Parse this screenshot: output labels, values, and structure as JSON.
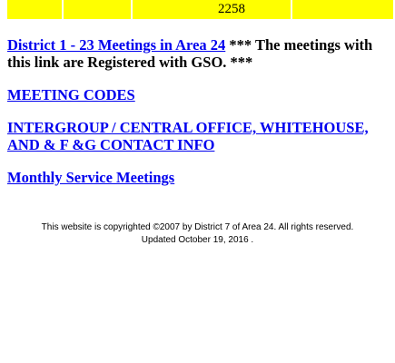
{
  "top_table": {
    "cells": [
      "",
      "",
      "2258",
      ""
    ],
    "background_color": "#ffff00"
  },
  "links": {
    "district_link": "District 1 - 23 Meetings in Area 24",
    "district_note": " *** The meetings with this link are Registered with GSO. ***",
    "meeting_codes": "MEETING CODES",
    "intergroup": "INTERGROUP / CENTRAL OFFICE, WHITEHOUSE, AND & F &G CONTACT INFO",
    "service_meetings": "Monthly Service Meetings",
    "link_color": "#0000ee"
  },
  "footer": {
    "copyright": "This website is copyrighted ©2007 by District 7 of Area 24. All rights reserved.",
    "updated": "Updated October 19, 2016 ."
  }
}
